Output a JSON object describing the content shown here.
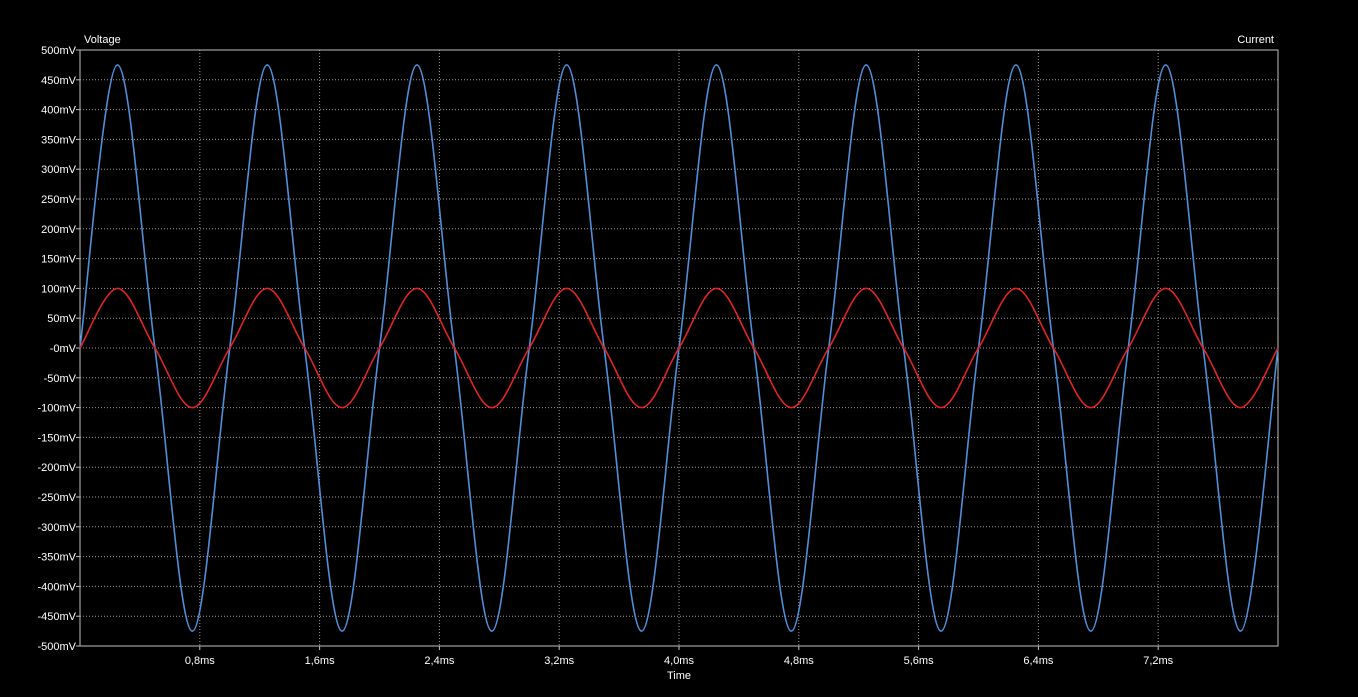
{
  "chart_data": {
    "type": "line",
    "title": "",
    "left_axis_title": "Voltage",
    "right_axis_title": "Current",
    "xlabel": "Time",
    "xlim": [
      0,
      8.0
    ],
    "ylim": [
      -500,
      500
    ],
    "x_ticks": [
      0.8,
      1.6,
      2.4,
      3.2,
      4.0,
      4.8,
      5.6,
      6.4,
      7.2
    ],
    "x_tick_labels": [
      "0,8ms",
      "1,6ms",
      "2,4ms",
      "3,2ms",
      "4,0ms",
      "4,8ms",
      "5,6ms",
      "6,4ms",
      "7,2ms"
    ],
    "y_ticks": [
      500,
      450,
      400,
      350,
      300,
      250,
      200,
      150,
      100,
      50,
      0,
      -50,
      -100,
      -150,
      -200,
      -250,
      -300,
      -350,
      -400,
      -450,
      -500
    ],
    "y_tick_labels": [
      "500mV",
      "450mV",
      "400mV",
      "350mV",
      "300mV",
      "250mV",
      "200mV",
      "150mV",
      "100mV",
      "50mV",
      "-0mV",
      "-50mV",
      "-100mV",
      "-150mV",
      "-200mV",
      "-250mV",
      "-300mV",
      "-350mV",
      "-400mV",
      "-450mV",
      "-500mV"
    ],
    "grid": true,
    "series": [
      {
        "color": "#4f8fd8",
        "x": [
          0,
          0.25,
          0.5,
          0.75,
          1.0,
          1.25,
          1.5,
          1.75,
          2.0,
          2.25,
          2.5,
          2.75,
          3.0,
          3.25,
          3.5,
          3.75,
          4.0,
          4.25,
          4.5,
          4.75,
          5.0,
          5.25,
          5.5,
          5.75,
          6.0,
          6.25,
          6.5,
          6.75,
          7.0,
          7.25,
          7.5,
          7.75,
          8.0
        ],
        "y": [
          0,
          475,
          0,
          -475,
          0,
          475,
          0,
          -475,
          0,
          475,
          0,
          -475,
          0,
          475,
          0,
          -475,
          0,
          475,
          0,
          -475,
          0,
          475,
          0,
          -475,
          0,
          475,
          0,
          -475,
          0,
          475,
          0,
          -475,
          0
        ]
      },
      {
        "color": "#e02424",
        "x": [
          0,
          0.25,
          0.5,
          0.75,
          1.0,
          1.25,
          1.5,
          1.75,
          2.0,
          2.25,
          2.5,
          2.75,
          3.0,
          3.25,
          3.5,
          3.75,
          4.0,
          4.25,
          4.5,
          4.75,
          5.0,
          5.25,
          5.5,
          5.75,
          6.0,
          6.25,
          6.5,
          6.75,
          7.0,
          7.25,
          7.5,
          7.75,
          8.0
        ],
        "y": [
          0,
          100,
          0,
          -100,
          0,
          100,
          0,
          -100,
          0,
          100,
          0,
          -100,
          0,
          100,
          0,
          -100,
          0,
          100,
          0,
          -100,
          0,
          100,
          0,
          -100,
          0,
          100,
          0,
          -100,
          0,
          100,
          0,
          -100,
          0
        ]
      }
    ]
  }
}
